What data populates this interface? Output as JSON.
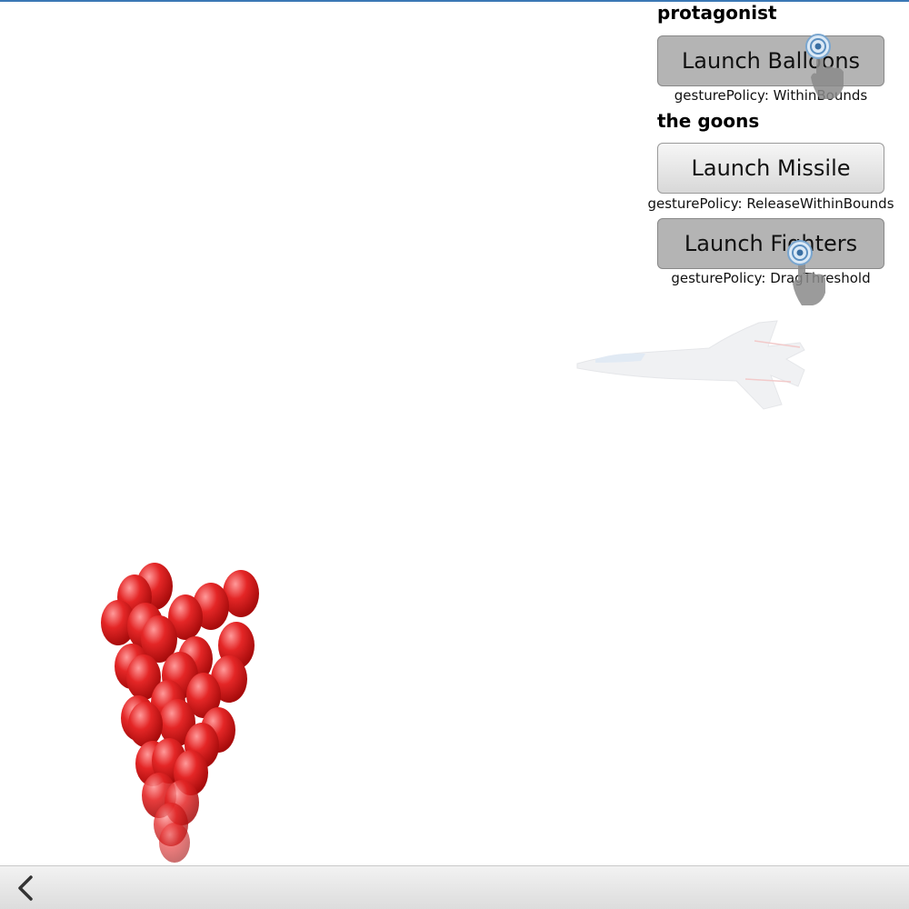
{
  "panel": {
    "protagonist_title": "protagonist",
    "goons_title": "the goons",
    "buttons": [
      {
        "label": "Launch Balloons",
        "policy": "gesturePolicy: WithinBounds",
        "pressed": true
      },
      {
        "label": "Launch Missile",
        "policy": "gesturePolicy: ReleaseWithinBounds",
        "pressed": false
      },
      {
        "label": "Launch Fighters",
        "policy": "gesturePolicy: DragThreshold",
        "pressed": true
      }
    ]
  },
  "scene": {
    "balloon_color": "#e02020",
    "top_line_color": "#3b78b5"
  },
  "toolbar": {
    "back_icon": "chevron-left-icon"
  }
}
